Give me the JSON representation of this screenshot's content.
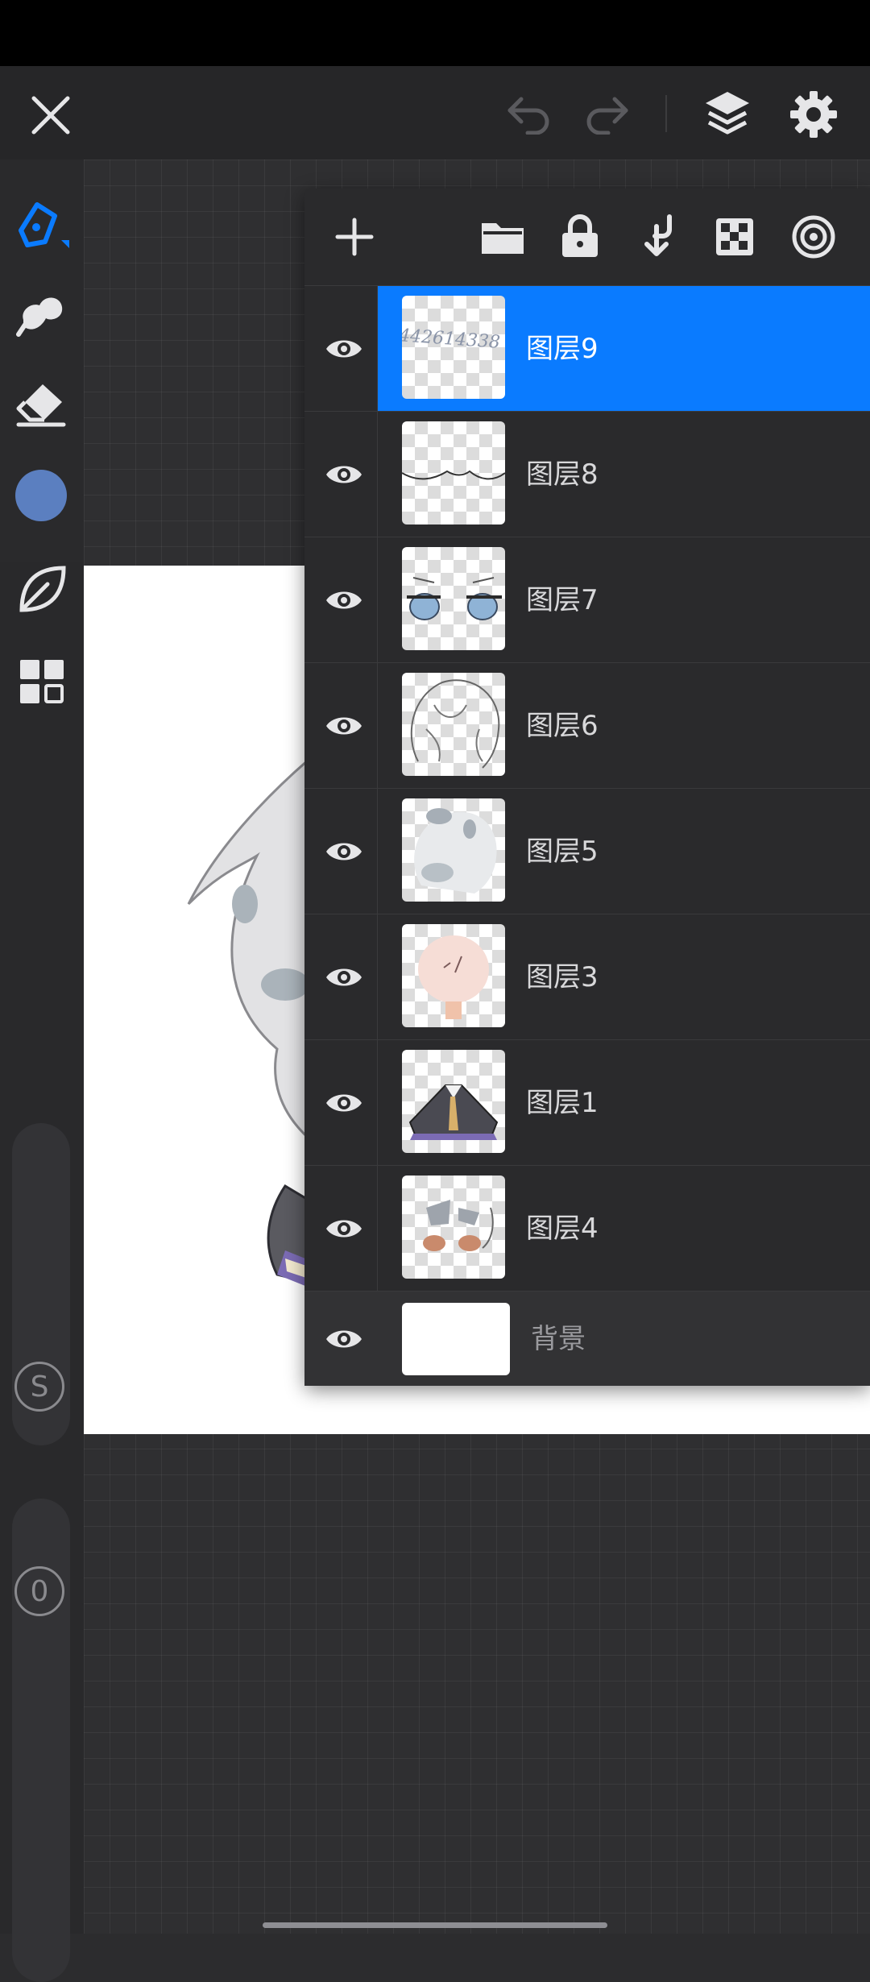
{
  "colors": {
    "accent": "#0a7bff",
    "current_brush_color": "#5b7fc0"
  },
  "topbar": {
    "close_icon": "close-icon",
    "undo_icon": "undo-icon",
    "redo_icon": "redo-icon",
    "layers_icon": "layers-icon",
    "settings_icon": "gear-icon"
  },
  "left_toolbar": {
    "tools": [
      "pen-tool",
      "smudge-tool",
      "eraser-tool",
      "color-swatch",
      "leaf-tool",
      "grid-tool"
    ],
    "size_slider_label": "S",
    "opacity_slider_label": "0"
  },
  "layers_panel": {
    "toolbar_icons": [
      "add-icon",
      "folder-icon",
      "lock-icon",
      "merge-down-icon",
      "transparency-icon",
      "target-icon"
    ],
    "layers": [
      {
        "name": "图层9",
        "thumb_text": "442614338",
        "selected": true
      },
      {
        "name": "图层8",
        "selected": false
      },
      {
        "name": "图层7",
        "selected": false
      },
      {
        "name": "图层6",
        "selected": false
      },
      {
        "name": "图层5",
        "selected": false
      },
      {
        "name": "图层3",
        "selected": false
      },
      {
        "name": "图层1",
        "selected": false
      },
      {
        "name": "图层4",
        "selected": false
      }
    ],
    "background_layer": {
      "name": "背景"
    }
  }
}
